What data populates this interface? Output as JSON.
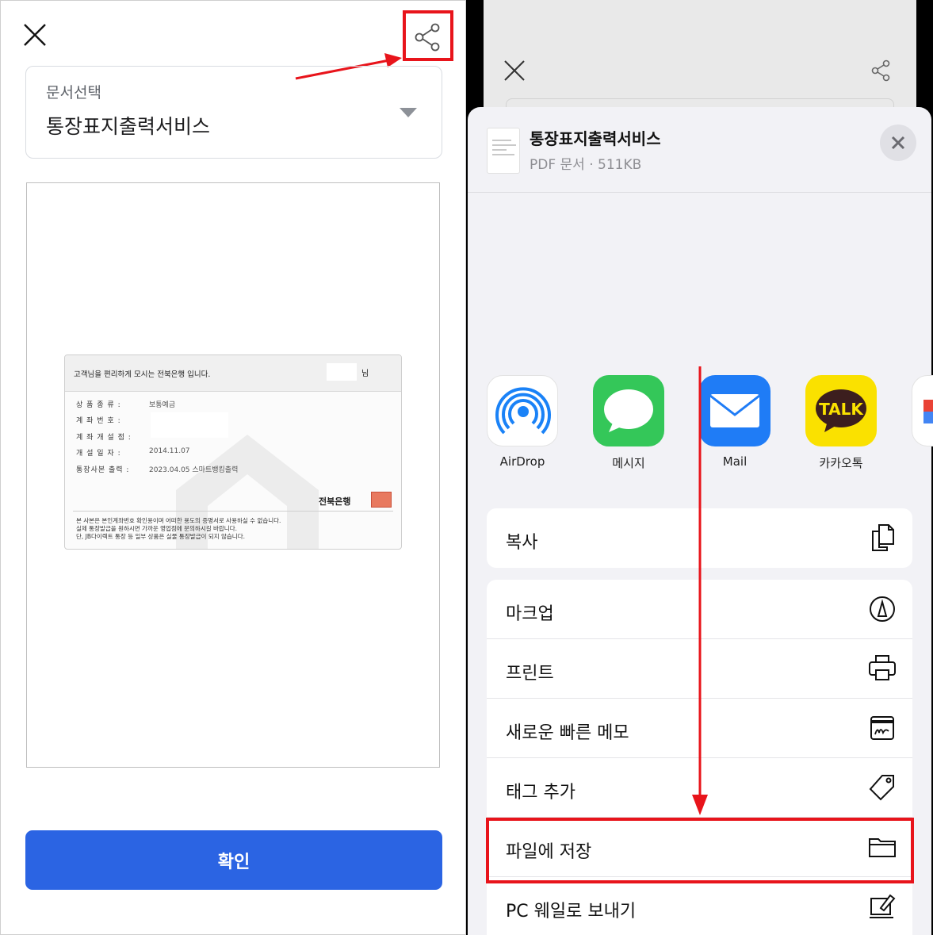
{
  "left": {
    "select_label": "문서선택",
    "select_value": "통장표지출력서비스",
    "card": {
      "greeting": "고객님을 편리하게 모시는 전북은행 입니다.",
      "suffix": "님",
      "rows": [
        {
          "label": "상 품 종 류 :",
          "value": "보통예금"
        },
        {
          "label": "계 좌 번 호 :",
          "value": ""
        },
        {
          "label": "계 좌 개 설 점 :",
          "value": ""
        },
        {
          "label": "개 설 일 자 :",
          "value": "2014.11.07"
        },
        {
          "label": "통장사본 출력 :",
          "value": "2023.04.05 스마트뱅킹출력"
        }
      ],
      "bank_logo": "전북은행",
      "notes": [
        "본 사본은 본인계좌번호 확인용이며 어떠한 용도의 증명서로 사용하실 수 없습니다.",
        "실제 통장발급을 원하시면 가까운 영업점에 문의하시길 바랍니다.",
        "단, JB다이렉트 통장 등 일부 상품은 실물 통장발급이 되지 않습니다."
      ]
    },
    "confirm_label": "확인"
  },
  "right": {
    "file": {
      "name": "통장표지출력서비스",
      "meta": "PDF 문서 · 511KB"
    },
    "apps": [
      {
        "name": "AirDrop",
        "icon": "airdrop-icon"
      },
      {
        "name": "메시지",
        "icon": "messages-icon"
      },
      {
        "name": "Mail",
        "icon": "mail-icon"
      },
      {
        "name": "카카오톡",
        "icon": "kakaotalk-icon",
        "badge": "TALK"
      }
    ],
    "actions_top": [
      {
        "label": "복사",
        "icon": "copy-icon"
      }
    ],
    "actions": [
      {
        "label": "마크업",
        "icon": "markup-icon"
      },
      {
        "label": "프린트",
        "icon": "print-icon"
      },
      {
        "label": "새로운 빠른 메모",
        "icon": "quick-note-icon"
      },
      {
        "label": "태그 추가",
        "icon": "tag-icon"
      },
      {
        "label": "파일에 저장",
        "icon": "folder-icon"
      },
      {
        "label": "PC 웨일로 보내기",
        "icon": "whale-send-icon"
      }
    ]
  },
  "colors": {
    "accent": "#2b64e3",
    "highlight": "#e8141b",
    "sheet": "#f2f2f6"
  }
}
